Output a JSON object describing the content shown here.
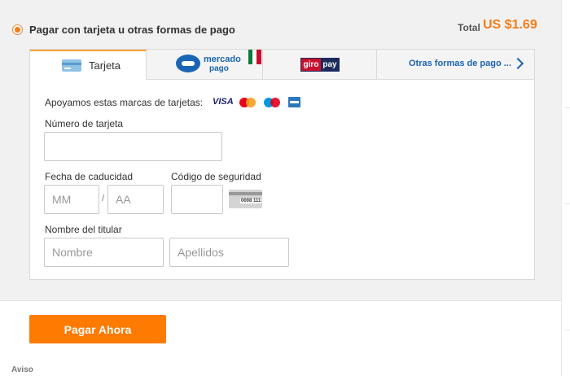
{
  "payment_option": {
    "label": "Pagar con tarjeta u otras formas de pago",
    "selected": true
  },
  "total": {
    "label": "Total",
    "amount": "US $1.69"
  },
  "tabs": [
    {
      "label": "Tarjeta",
      "icon": "credit-card-icon",
      "active": true
    },
    {
      "label_line1": "mercado",
      "label_line2": "pago",
      "icon": "mercado-pago-logo",
      "badge_icon": "mexico-flag-icon"
    },
    {
      "label_left": "giro",
      "label_right": "pay",
      "icon": "giropay-logo"
    },
    {
      "label": "Otras formas de pago ...",
      "icon": "chevron-right-icon"
    }
  ],
  "card_form": {
    "brands_label": "Apoyamos estas marcas de tarjetas:",
    "brands": [
      "VISA",
      "mastercard",
      "Maestro",
      "amex"
    ],
    "card_number": {
      "label": "Número de tarjeta",
      "value": "",
      "placeholder": ""
    },
    "expiry": {
      "label": "Fecha de caducidad",
      "month_placeholder": "MM",
      "separator": "/",
      "year_placeholder": "AA"
    },
    "security_code": {
      "label": "Código de seguridad",
      "value": "",
      "image_text": "0008 111"
    },
    "holder": {
      "label": "Nombre del titular",
      "first_placeholder": "Nombre",
      "last_placeholder": "Apellidos"
    }
  },
  "pay_button": {
    "label": "Pagar Ahora"
  },
  "notice": {
    "label": "Aviso"
  },
  "colors": {
    "accent_orange": "#ff7a00",
    "total_orange": "#f57c19",
    "link_blue": "#1a64b4",
    "panel_gray": "#f1f1f1"
  }
}
